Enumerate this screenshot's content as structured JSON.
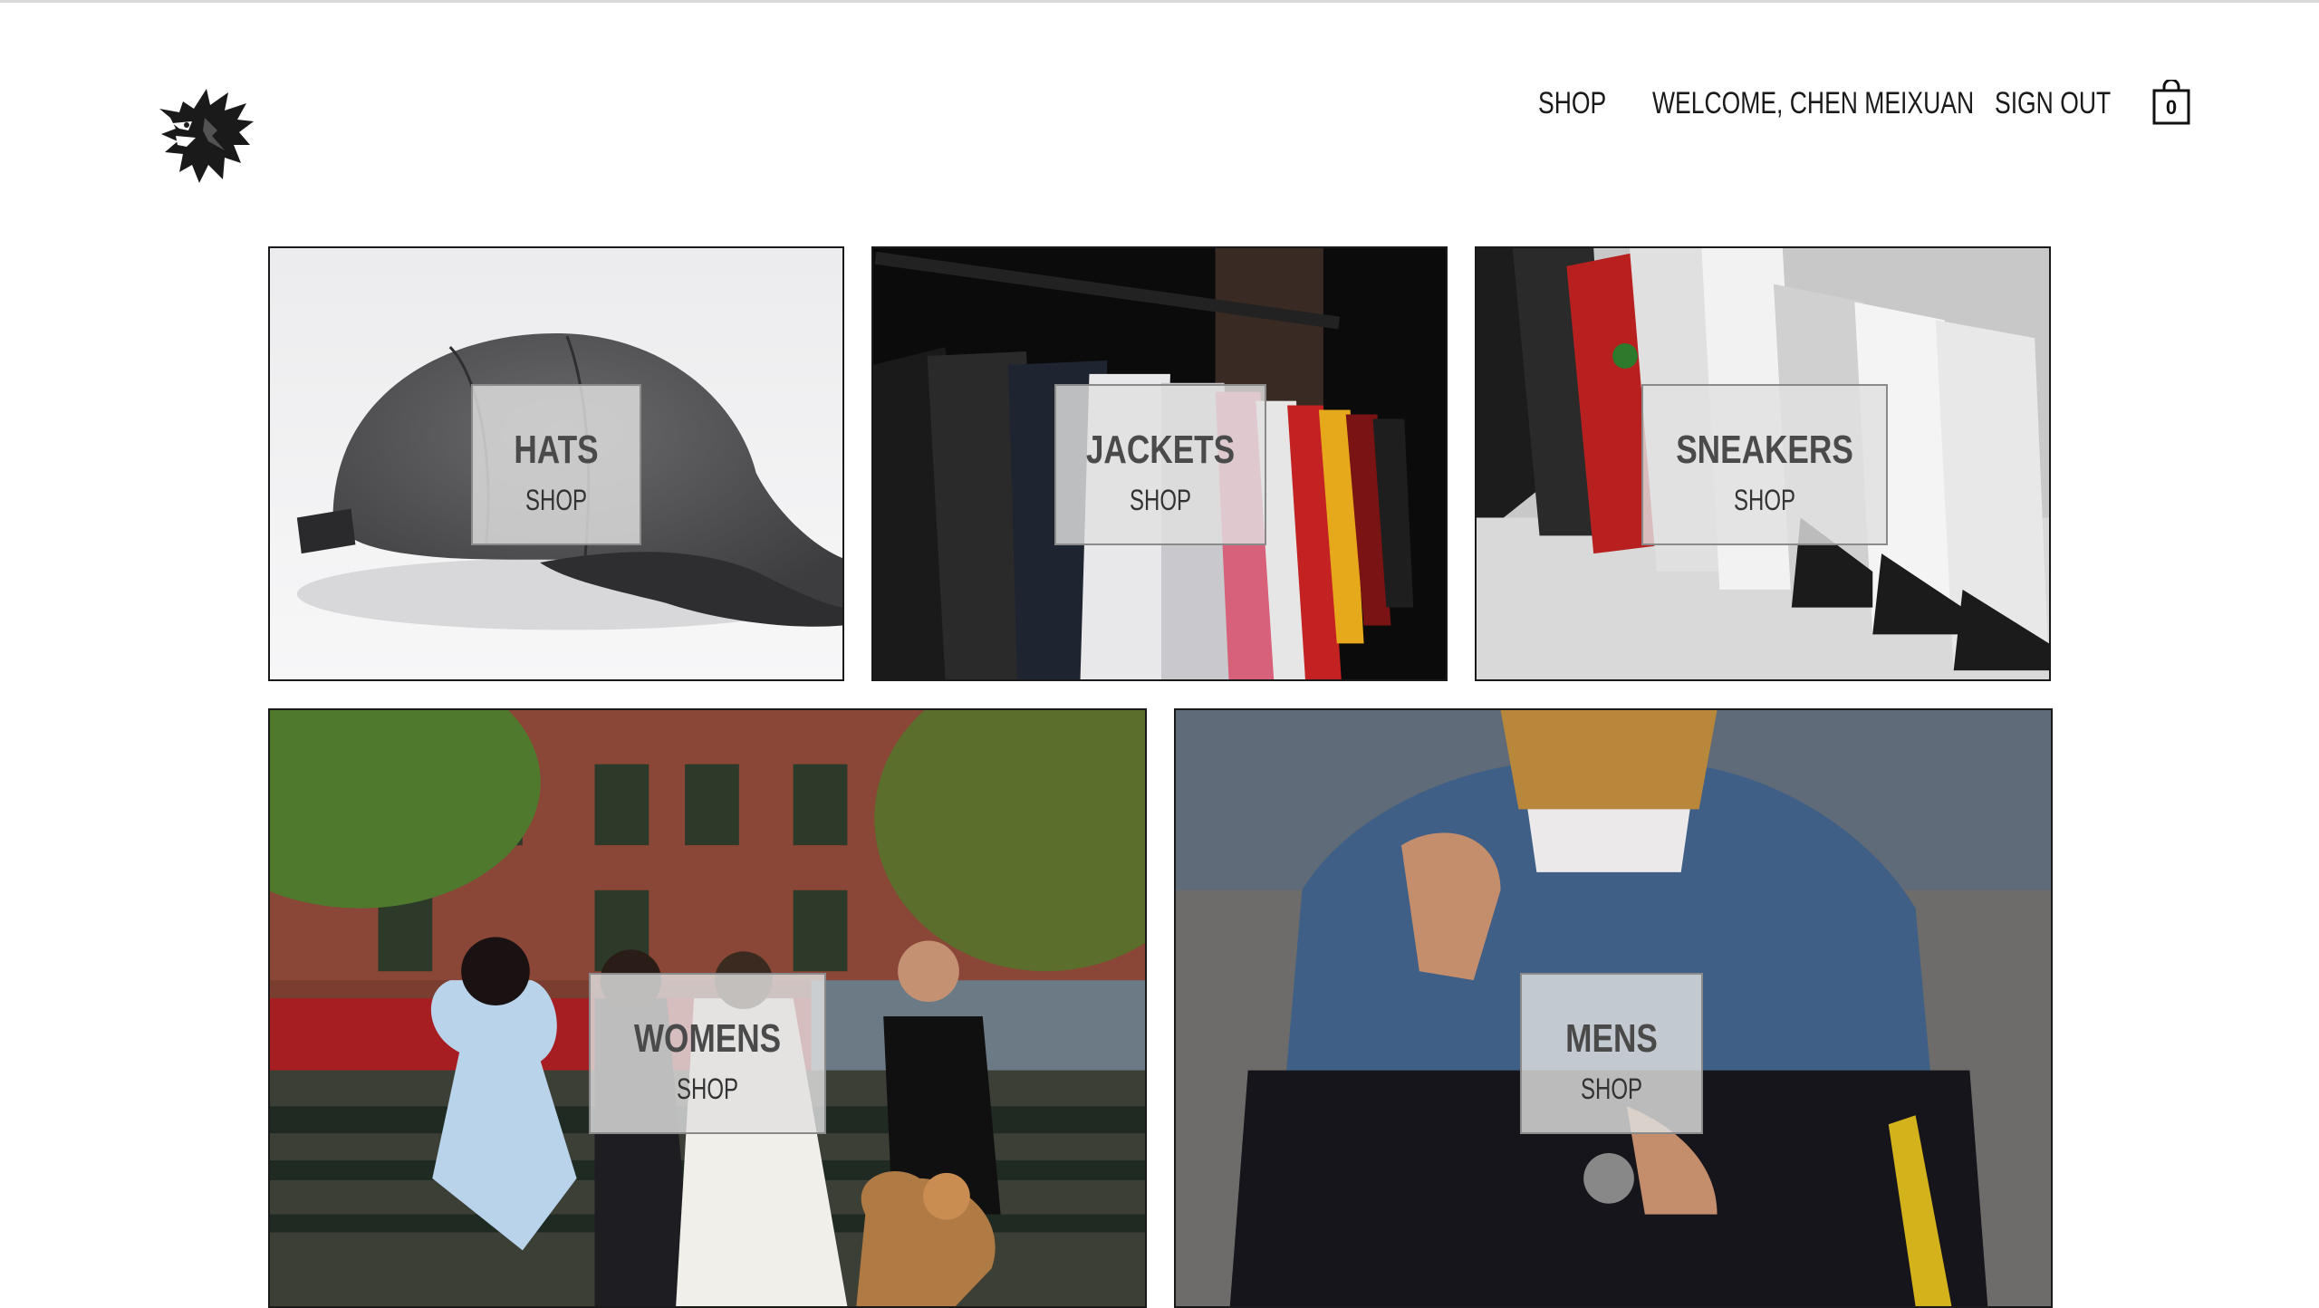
{
  "header": {
    "logo_icon": "griffin-head-logo-icon",
    "nav": {
      "shop": "SHOP",
      "welcome": "WELCOME, CHEN MEIXUAN",
      "sign_out": "SIGN OUT"
    },
    "cart": {
      "icon": "shopping-bag-icon",
      "count": "0"
    }
  },
  "categories": [
    {
      "title": "HATS",
      "action": "SHOP",
      "image": "gray-baseball-cap-photo"
    },
    {
      "title": "JACKETS",
      "action": "SHOP",
      "image": "jackets-on-rack-photo"
    },
    {
      "title": "SNEAKERS",
      "action": "SHOP",
      "image": "sneakers-row-photo"
    },
    {
      "title": "WOMENS",
      "action": "SHOP",
      "image": "women-on-bench-photo"
    },
    {
      "title": "MENS",
      "action": "SHOP",
      "image": "man-in-denim-jacket-photo"
    }
  ],
  "colors": {
    "text": "#1a1a1a",
    "label_bg": "#e1e1e1",
    "border": "#1a1a1a"
  }
}
